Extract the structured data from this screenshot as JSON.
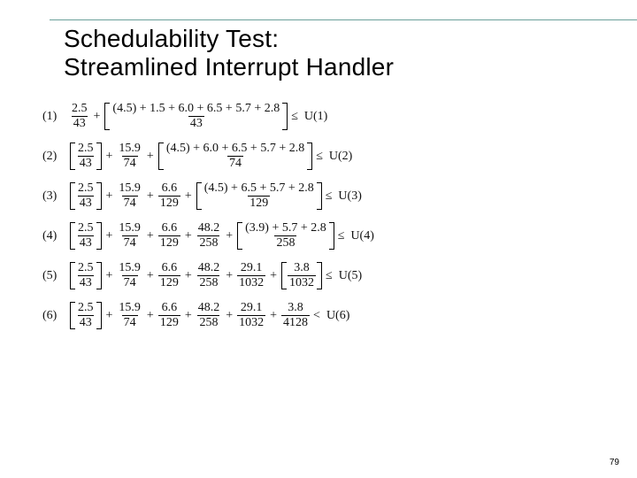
{
  "title_line1": "Schedulability Test:",
  "title_line2": "Streamlined Interrupt Handler",
  "page_number": "79",
  "plus": "+",
  "le": "≤",
  "lt": "<",
  "eq": [
    {
      "idx": "(1)",
      "terms": [
        {
          "bracket": false,
          "num": "2.5",
          "den": "43"
        },
        {
          "bracket": true,
          "num": "(4.5) + 1.5 + 6.0 + 6.5 + 5.7 + 2.8",
          "den": "43"
        }
      ],
      "cmp": "le",
      "rhs": "U(1)"
    },
    {
      "idx": "(2)",
      "terms": [
        {
          "bracket": true,
          "num": "2.5",
          "den": "43"
        },
        {
          "bracket": false,
          "num": "15.9",
          "den": "74"
        },
        {
          "bracket": true,
          "num": "(4.5) + 6.0 + 6.5 + 5.7 + 2.8",
          "den": "74"
        }
      ],
      "cmp": "le",
      "rhs": "U(2)"
    },
    {
      "idx": "(3)",
      "terms": [
        {
          "bracket": true,
          "num": "2.5",
          "den": "43"
        },
        {
          "bracket": false,
          "num": "15.9",
          "den": "74"
        },
        {
          "bracket": false,
          "num": "6.6",
          "den": "129"
        },
        {
          "bracket": true,
          "num": "(4.5) + 6.5 + 5.7 + 2.8",
          "den": "129"
        }
      ],
      "cmp": "le",
      "rhs": "U(3)"
    },
    {
      "idx": "(4)",
      "terms": [
        {
          "bracket": true,
          "num": "2.5",
          "den": "43"
        },
        {
          "bracket": false,
          "num": "15.9",
          "den": "74"
        },
        {
          "bracket": false,
          "num": "6.6",
          "den": "129"
        },
        {
          "bracket": false,
          "num": "48.2",
          "den": "258"
        },
        {
          "bracket": true,
          "num": "(3.9) + 5.7 + 2.8",
          "den": "258"
        }
      ],
      "cmp": "le",
      "rhs": "U(4)"
    },
    {
      "idx": "(5)",
      "terms": [
        {
          "bracket": true,
          "num": "2.5",
          "den": "43"
        },
        {
          "bracket": false,
          "num": "15.9",
          "den": "74"
        },
        {
          "bracket": false,
          "num": "6.6",
          "den": "129"
        },
        {
          "bracket": false,
          "num": "48.2",
          "den": "258"
        },
        {
          "bracket": false,
          "num": "29.1",
          "den": "1032"
        },
        {
          "bracket": true,
          "num": "3.8",
          "den": "1032"
        }
      ],
      "cmp": "le",
      "rhs": "U(5)"
    },
    {
      "idx": "(6)",
      "terms": [
        {
          "bracket": true,
          "num": "2.5",
          "den": "43"
        },
        {
          "bracket": false,
          "num": "15.9",
          "den": "74"
        },
        {
          "bracket": false,
          "num": "6.6",
          "den": "129"
        },
        {
          "bracket": false,
          "num": "48.2",
          "den": "258"
        },
        {
          "bracket": false,
          "num": "29.1",
          "den": "1032"
        },
        {
          "bracket": false,
          "num": "3.8",
          "den": "4128"
        }
      ],
      "cmp": "lt",
      "rhs": "U(6)"
    }
  ]
}
